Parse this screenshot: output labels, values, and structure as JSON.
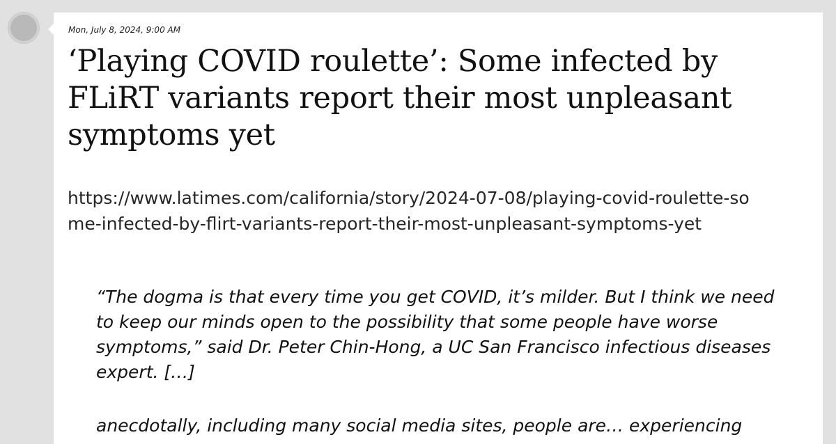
{
  "post": {
    "timestamp": "Mon, July 8, 2024, 9:00 AM",
    "title": "‘Playing COVID roulette’: Some infected by FLiRT variants report their most unpleasant symptoms yet",
    "url": "https://www.latimes.com/california/story/2024-07-08/playing-covid-roulette-some-infected-by-flirt-variants-report-their-most-unpleasant-symptoms-yet",
    "quote": "“The dogma is that every time you get COVID, it’s milder. But I think we need to keep our minds open to the possibility that some people have worse symptoms,” said Dr. Peter Chin-Hong, a UC San Francisco infectious diseases expert. […]",
    "quote_continued": "anecdotally, including many social media sites, people are… experiencing"
  }
}
